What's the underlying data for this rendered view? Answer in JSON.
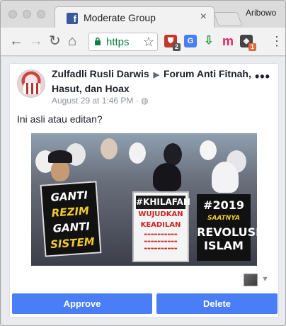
{
  "browser": {
    "tab_title": "Moderate Group",
    "tab_favicon": "facebook-icon",
    "profile_name": "Aribowo",
    "url_display": "https",
    "url_color": "#0b8043"
  },
  "extensions": [
    {
      "name": "shield-extension-icon",
      "badge": "2",
      "color": "#c0392b"
    },
    {
      "name": "translate-extension-icon",
      "badge": "",
      "color": "#4a7ef6"
    },
    {
      "name": "download-extension-icon",
      "badge": "",
      "color": "#2e9e44"
    },
    {
      "name": "m-extension-icon",
      "badge": "",
      "color": "#e0245e"
    },
    {
      "name": "notification-extension-icon",
      "badge": "1",
      "color": "#e8663d"
    }
  ],
  "post": {
    "author": "Zulfadli Rusli Darwis",
    "group": "Forum Anti Fitnah, Hasut, dan Hoax",
    "timestamp": "August 29 at 1:46 PM",
    "privacy_icon": "globe-icon",
    "caption": "Ini asli atau editan?",
    "signs": {
      "left": [
        "GANTI",
        "REZIM",
        "GANTI",
        "SISTEM"
      ],
      "middle_header": "#KHILAFAH",
      "middle_lines": [
        "WUJUDKAN",
        "KEADILAN"
      ],
      "right_top": "#2019",
      "right_sub": "SAATNYA",
      "right_bottom": [
        "REVOLUSI",
        "ISLAM"
      ]
    }
  },
  "actions": {
    "approve_label": "Approve",
    "delete_label": "Delete",
    "button_color": "#4a7ef6"
  }
}
